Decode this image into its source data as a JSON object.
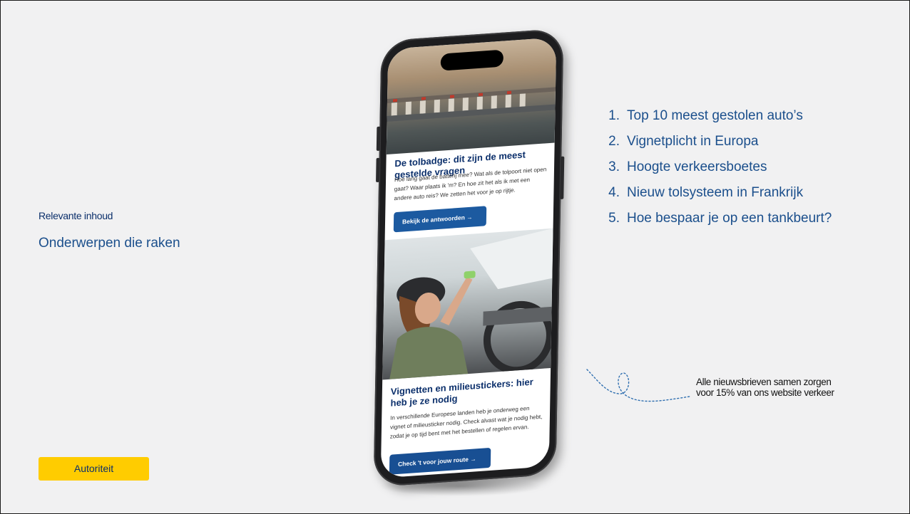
{
  "slide": {
    "eyebrow": "Relevante inhoud",
    "subtitle": "Onderwerpen die raken",
    "tag": "Autoriteit",
    "tag_color": "#ffcc00",
    "text_color": "#1b4f8c"
  },
  "topics": [
    {
      "num": "1.",
      "label": "Top 10 meest gestolen auto’s"
    },
    {
      "num": "2.",
      "label": "Vignetplicht in Europa"
    },
    {
      "num": "3.",
      "label": "Hoogte verkeersboetes"
    },
    {
      "num": "4.",
      "label": "Nieuw tolsysteem in Frankrijk"
    },
    {
      "num": "5.",
      "label": "Hoe bespaar je op een tankbeurt?"
    }
  ],
  "note": "Alle nieuwsbrieven samen zorgen voor 15% van ons website verkeer",
  "phone": {
    "article1": {
      "title": "De tolbadge: dit zijn de meest gestelde vragen",
      "body": "Hoe lang gaat de batterij mee? Wat als de tolpoort niet open gaat? Waar plaats ik 'm? En hoe zit het als ik met een andere auto reis? We zetten het voor je op rijtje.",
      "button": "Bekijk de antwoorden →"
    },
    "article2": {
      "title": "Vignetten en milieustickers: hier heb je ze nodig",
      "body": "In verschillende Europese landen heb je onderweg een vignet of milieusticker nodig. Check alvast wat je nodig hebt, zodat je op tijd bent met het bestellen of regelen ervan.",
      "button": "Check 't voor jouw route →"
    },
    "button_color": "#1c5aa0"
  }
}
